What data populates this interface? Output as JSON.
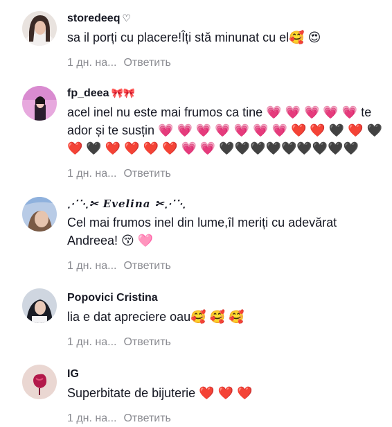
{
  "comments": [
    {
      "username": "storedeeq",
      "username_suffix": "♡",
      "text": "sa il porți cu placere!Îți stă minunat cu el🥰 😍",
      "time": "1 дн. на...",
      "reply_label": "Ответить"
    },
    {
      "username": "fp_deea",
      "username_suffix": "🎀🎀",
      "text": "acel inel nu este mai frumos ca tine 💗 💗 💗 💗 💗 te ador și te susțin 💗 💗 💗 💗 💗 💗 💗 ❤️ ❤️ 🖤 ❤️ 🖤 ❤️ 🖤 ❤️ ❤️ ❤️ ❤️ 💗 💗 🖤🖤🖤🖤🖤🖤🖤🖤🖤",
      "time": "1 дн. на...",
      "reply_label": "Ответить"
    },
    {
      "username": "⋰⋱✂ Evelina ✂⋰⋱",
      "username_suffix": "",
      "text": "Cel mai frumos inel din lume,îl meriți cu adevărat Andreea! 😚 🩷",
      "time": "1 дн. на...",
      "reply_label": "Ответить"
    },
    {
      "username": "Popovici Cristina",
      "username_suffix": "",
      "text": "lia e dat apreciere oau🥰 🥰 🥰",
      "time": "1 дн. на...",
      "reply_label": "Ответить"
    },
    {
      "username": "IG",
      "username_suffix": "",
      "text": "Superbitate de bijuterie ❤️ ❤️ ❤️",
      "time": "1 дн. на...",
      "reply_label": "Ответить"
    }
  ],
  "colors": {
    "text": "#161823",
    "meta": "#8a8b91"
  }
}
